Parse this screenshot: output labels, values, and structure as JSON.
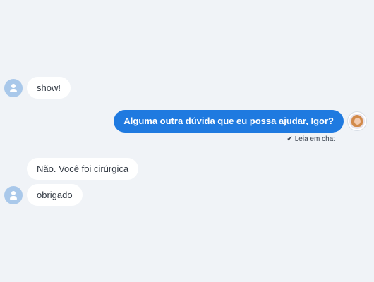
{
  "messages": {
    "m1": {
      "text": "show!"
    },
    "m2": {
      "text": "Alguma outra dúvida que eu possa ajudar, Igor?",
      "receipt": "Leia em chat",
      "receipt_icon": "✔"
    },
    "m3": {
      "text": "Não. Você foi cirúrgica"
    },
    "m4": {
      "text": "obrigado"
    }
  },
  "colors": {
    "background": "#f0f3f7",
    "outgoing_bubble": "#1f7ae0",
    "incoming_bubble": "#ffffff",
    "user_avatar": "#a9c8ea"
  }
}
